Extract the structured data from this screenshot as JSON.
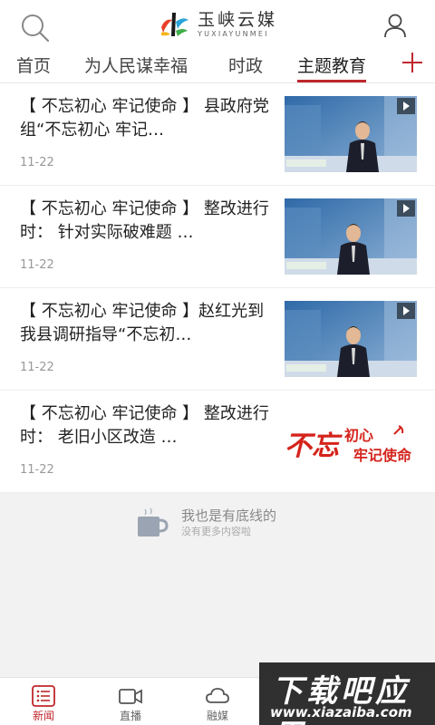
{
  "header": {
    "logo_cn": "玉峡云媒",
    "logo_en": "YUXIAYUNMEI"
  },
  "tabs": [
    {
      "label": "首页",
      "active": false
    },
    {
      "label": "为人民谋幸福",
      "active": false
    },
    {
      "label": "时政",
      "active": false
    },
    {
      "label": "主题教育",
      "active": true
    }
  ],
  "news": [
    {
      "title": "【 不忘初心  牢记使命 】 县政府党组“不忘初心  牢记…",
      "date": "11-22",
      "thumb": "video"
    },
    {
      "title": "【 不忘初心  牢记使命 】 整改进行时： 针对实际破难题 …",
      "date": "11-22",
      "thumb": "video"
    },
    {
      "title": "【 不忘初心  牢记使命 】赵红光到我县调研指导“不忘初…",
      "date": "11-22",
      "thumb": "video"
    },
    {
      "title": "【 不忘初心   牢记使命 】  整改进行时： 老旧小区改造 …",
      "date": "11-22",
      "thumb": "banner",
      "banner_left": "不忘",
      "banner_right_1": "初心",
      "banner_right_2": "牢记使命"
    }
  ],
  "thumb_video_caption": "城 关 农 商 银 行",
  "end": {
    "main": "我也是有底线的",
    "sub": "没有更多内容啦"
  },
  "bottom_nav": [
    {
      "label": "新闻",
      "icon": "list-icon",
      "active": true
    },
    {
      "label": "直播",
      "icon": "video-camera-icon",
      "active": false
    },
    {
      "label": "融媒",
      "icon": "cloud-icon",
      "active": false
    }
  ],
  "watermark": {
    "cn": "下载吧应用",
    "en": "www.xiazaiba.com"
  },
  "colors": {
    "accent": "#c0272d",
    "text": "#222222",
    "muted": "#999999"
  }
}
